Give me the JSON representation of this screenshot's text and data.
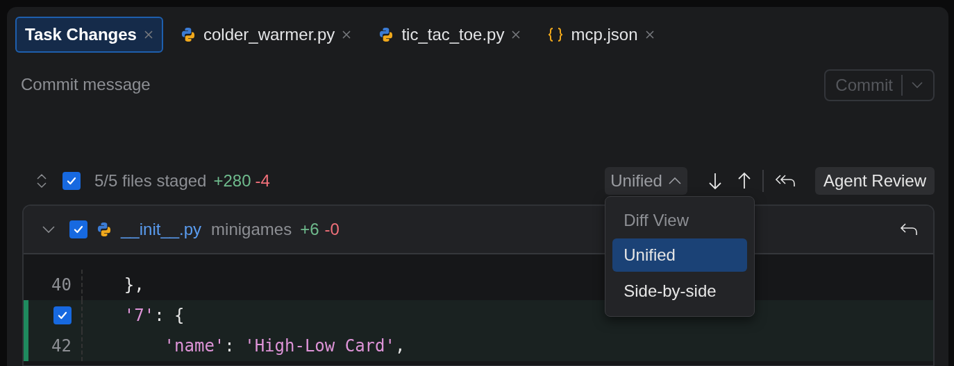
{
  "tabs": [
    {
      "label": "Task Changes",
      "kind": "task",
      "selected": true
    },
    {
      "label": "colder_warmer.py",
      "kind": "python",
      "selected": false
    },
    {
      "label": "tic_tac_toe.py",
      "kind": "python",
      "selected": false
    },
    {
      "label": "mcp.json",
      "kind": "json",
      "selected": false
    }
  ],
  "commit": {
    "placeholder": "Commit message",
    "button": "Commit",
    "disabled": true
  },
  "toolbar": {
    "all_checked": true,
    "summary": "5/5 files staged",
    "added": "+280",
    "removed": "-4",
    "view": "Unified",
    "review": "Agent Review"
  },
  "diff_menu": {
    "title": "Diff View",
    "options": [
      {
        "label": "Unified",
        "selected": true
      },
      {
        "label": "Side-by-side",
        "selected": false
      }
    ]
  },
  "file": {
    "expanded": true,
    "checked": true,
    "name": "__init__.py",
    "folder": "minigames",
    "added": "+6",
    "removed": "-0",
    "lines": [
      {
        "number": "40",
        "added": false,
        "tokens": [
          {
            "kind": "plain",
            "text": "    },"
          }
        ]
      },
      {
        "checked": true,
        "added": true,
        "tokens": [
          {
            "kind": "string",
            "text": "    '7'"
          },
          {
            "kind": "plain",
            "text": ": {"
          }
        ]
      },
      {
        "number": "42",
        "added": true,
        "tokens": [
          {
            "kind": "string",
            "text": "        'name'"
          },
          {
            "kind": "plain",
            "text": ": "
          },
          {
            "kind": "string",
            "text": "'High-Low Card'"
          },
          {
            "kind": "plain",
            "text": ","
          }
        ]
      }
    ]
  }
}
